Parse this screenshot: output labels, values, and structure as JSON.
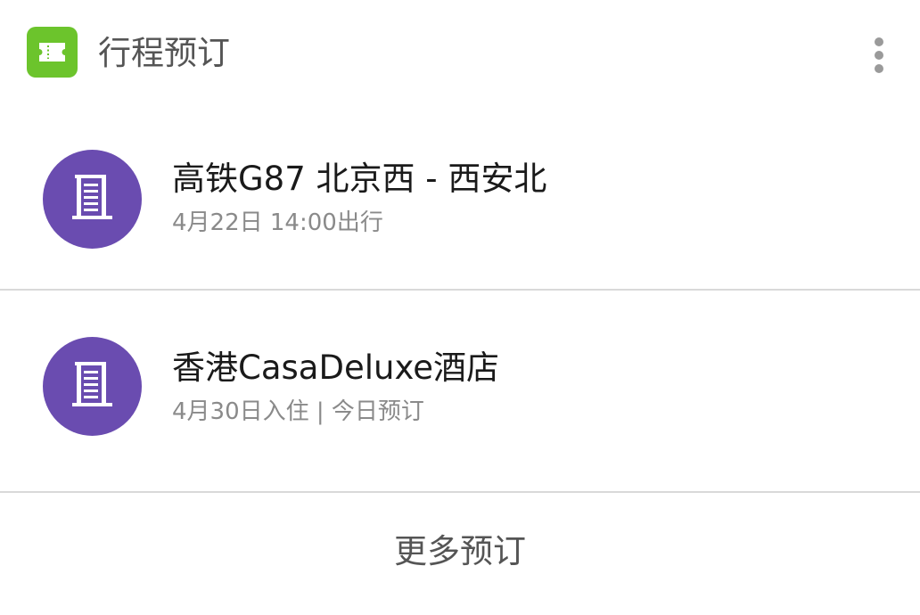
{
  "header": {
    "app_icon": "ticket-icon",
    "title": "行程预订",
    "menu_icon": "more-vertical-icon"
  },
  "bookings": [
    {
      "icon": "building-icon",
      "title": "高铁G87  北京西 - 西安北",
      "subtitle": "4月22日 14:00出行"
    },
    {
      "icon": "building-icon",
      "title": "香港CasaDeluxe酒店",
      "subtitle": "4月30日入住 | 今日预订"
    }
  ],
  "footer": {
    "more_label": "更多预订"
  },
  "colors": {
    "app_icon_bg": "#6cc42c",
    "avatar_bg": "#6a4cb0",
    "divider": "#d9d9d9",
    "title_text": "#1a1a1a",
    "secondary_text": "#8a8a8a",
    "header_text": "#555555"
  }
}
